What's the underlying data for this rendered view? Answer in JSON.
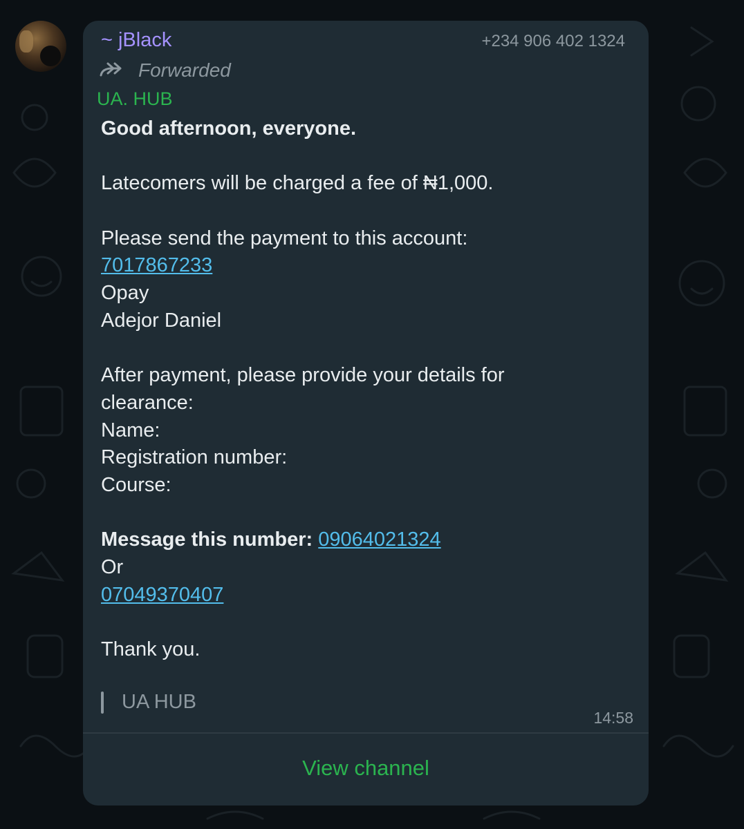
{
  "message": {
    "sender": "~ jBlack",
    "phone": "+234 906 402 1324",
    "forwarded_label": "Forwarded",
    "channel_name": "UA. HUB",
    "greeting": "Good afternoon, everyone.",
    "late_fee_line": "Latecomers will be charged a fee of ₦1,000.",
    "payment_intro": "Please send the payment to this account:",
    "account_number": "7017867233",
    "bank": "Opay",
    "account_name": "Adejor Daniel",
    "details_line1": "After payment, please provide your details for",
    "details_line2": "clearance:",
    "field_name": "Name:",
    "field_reg": "Registration number:",
    "field_course": "Course:",
    "contact_label": "Message this number: ",
    "contact_number1": "09064021324",
    "or_text": "Or",
    "contact_number2": "07049370407",
    "thanks": "Thank you.",
    "quote_source": "UA HUB",
    "time": "14:58",
    "view_channel_label": "View channel"
  },
  "colors": {
    "background": "#0b1014",
    "bubble": "#1f2c34",
    "sender": "#a592ff",
    "channel": "#2bb44f",
    "link": "#53bdeb",
    "text": "#e9edef",
    "muted": "#8d989f"
  },
  "icons": [
    "avatar",
    "forward-arrow-icon"
  ]
}
